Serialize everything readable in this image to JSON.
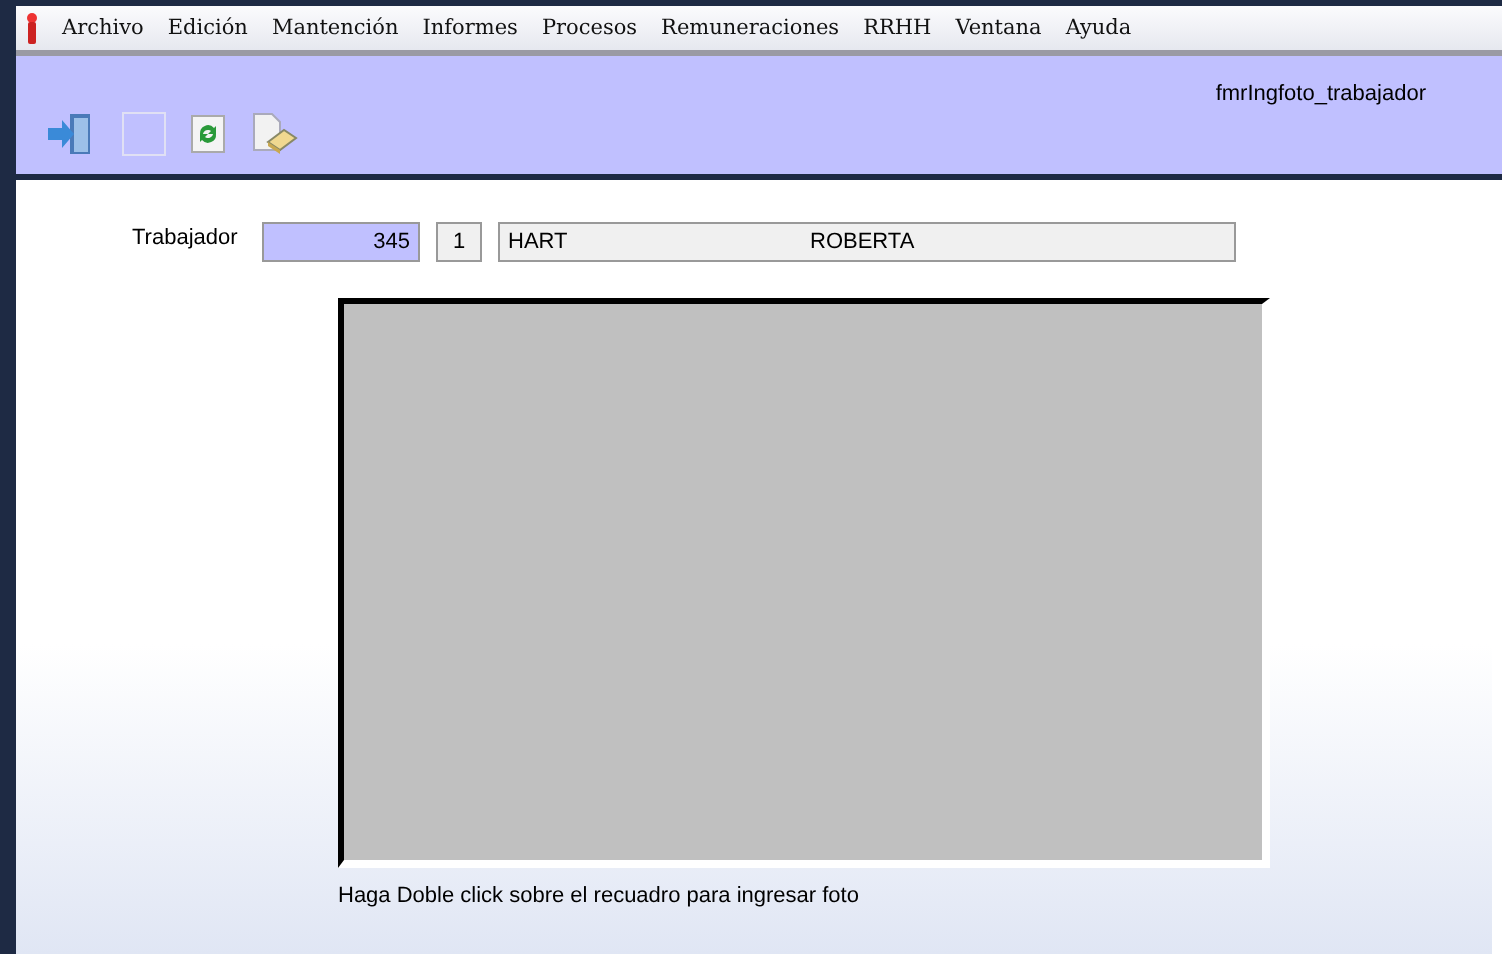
{
  "menu_bar": {
    "items": [
      "Archivo",
      "Edición",
      "Mantención",
      "Informes",
      "Procesos",
      "Remuneraciones",
      "RRHH",
      "Ventana",
      "Ayuda"
    ]
  },
  "toolbar": {
    "tools": [
      {
        "kind": "exit"
      },
      {
        "kind": "blank"
      },
      {
        "kind": "refresh"
      },
      {
        "kind": "erase"
      }
    ],
    "form_name": "fmrIngfoto_trabajador"
  },
  "form": {
    "label": "Trabajador",
    "code": "345",
    "number": "1",
    "last_name": "HART",
    "first_name": "ROBERTA",
    "photo": {
      "kind": "empty"
    },
    "hint": "Haga Doble click sobre el recuadro para ingresar foto"
  }
}
